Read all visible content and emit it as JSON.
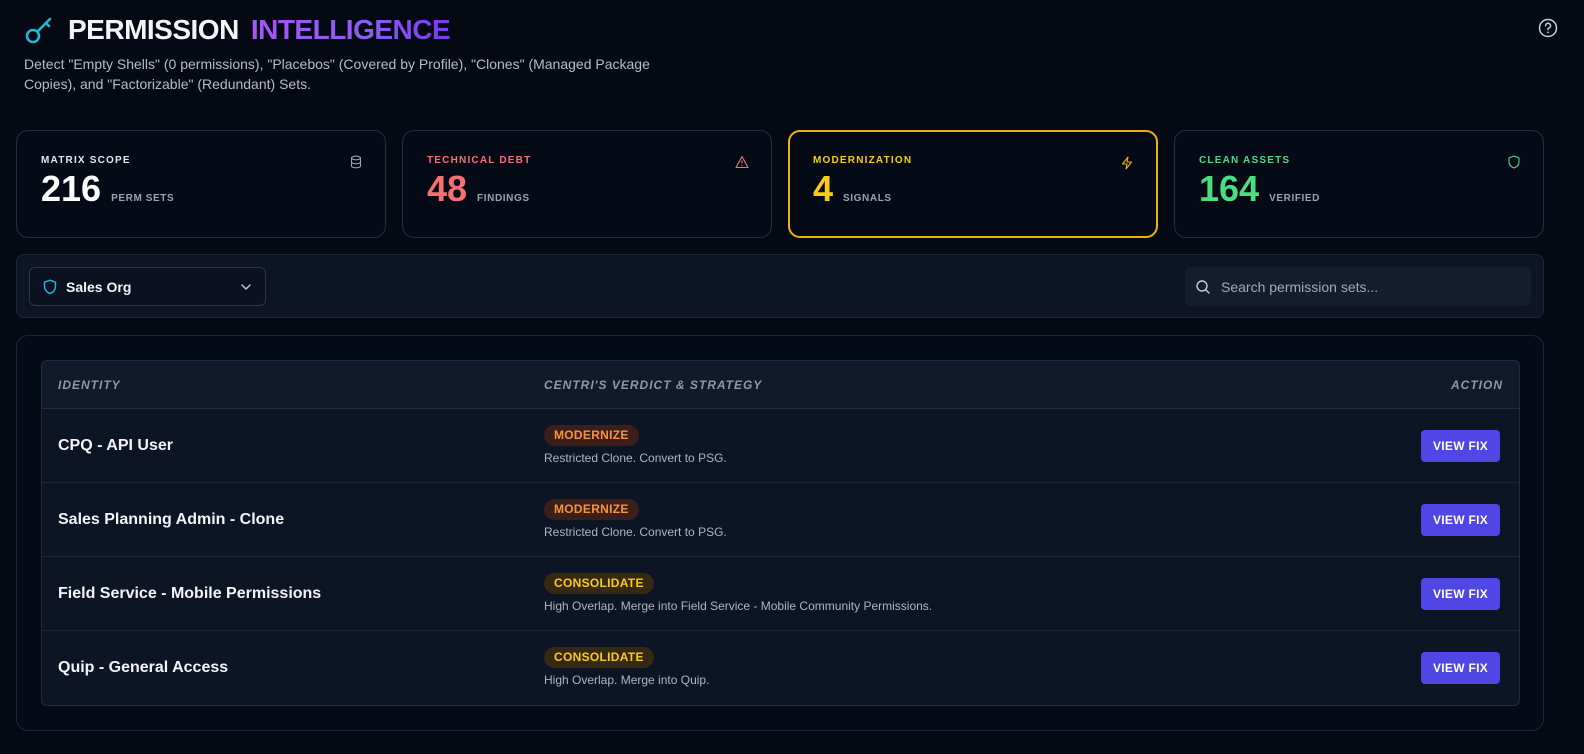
{
  "header": {
    "title_primary": "PERMISSION",
    "title_accent": "INTELLIGENCE",
    "subtitle": "Detect \"Empty Shells\" (0 permissions), \"Placebos\" (Covered by Profile), \"Clones\" (Managed Package Copies), and \"Factorizable\" (Redundant) Sets."
  },
  "stats": [
    {
      "label": "MATRIX SCOPE",
      "value": "216",
      "unit": "PERM SETS",
      "icon": "database-icon",
      "color": "#e5e7eb",
      "value_color": "#ffffff"
    },
    {
      "label": "TECHNICAL DEBT",
      "value": "48",
      "unit": "FINDINGS",
      "icon": "warning-icon",
      "color": "#f87171",
      "value_color": "#f87171"
    },
    {
      "label": "MODERNIZATION",
      "value": "4",
      "unit": "SIGNALS",
      "icon": "bolt-icon",
      "color": "#facc15",
      "value_color": "#facc15"
    },
    {
      "label": "CLEAN ASSETS",
      "value": "164",
      "unit": "VERIFIED",
      "icon": "shield-check-icon",
      "color": "#4ade80",
      "value_color": "#4ade80"
    }
  ],
  "toolbar": {
    "org_selected": "Sales Org",
    "search_placeholder": "Search permission sets..."
  },
  "table": {
    "columns": [
      "IDENTITY",
      "CENTRI'S VERDICT & STRATEGY",
      "ACTION"
    ],
    "rows": [
      {
        "identity": "CPQ - API User",
        "verdict": "MODERNIZE",
        "strategy": "Restricted Clone. Convert to PSG.",
        "action": "VIEW FIX"
      },
      {
        "identity": "Sales Planning Admin - Clone",
        "verdict": "MODERNIZE",
        "strategy": "Restricted Clone. Convert to PSG.",
        "action": "VIEW FIX"
      },
      {
        "identity": "Field Service - Mobile Permissions",
        "verdict": "CONSOLIDATE",
        "strategy": "High Overlap. Merge into Field Service - Mobile Community Permissions.",
        "action": "VIEW FIX"
      },
      {
        "identity": "Quip - General Access",
        "verdict": "CONSOLIDATE",
        "strategy": "High Overlap. Merge into Quip.",
        "action": "VIEW FIX"
      }
    ]
  },
  "colors": {
    "accent_purple": "#8b5cf6",
    "accent_cyan": "#22b8cf",
    "button": "#4f46e5",
    "highlight_border": "#eab308"
  }
}
